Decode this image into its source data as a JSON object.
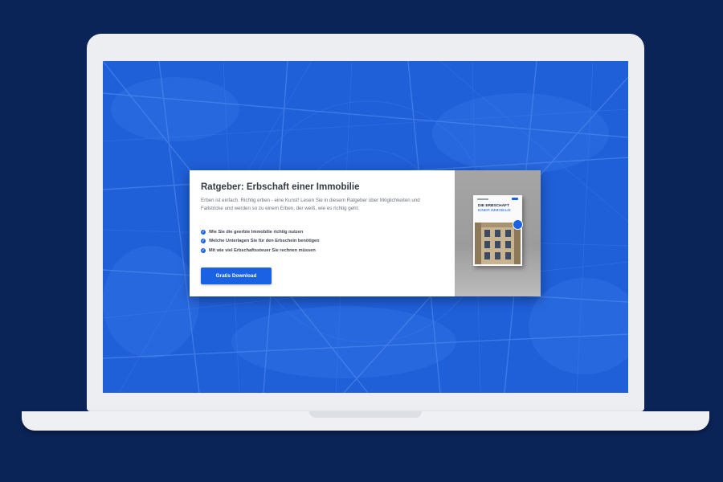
{
  "card": {
    "title": "Ratgeber: Erbschaft einer Immobilie",
    "description": "Erben ist einfach. Richtig erben - eine Kunst! Lesen Sie in diesem Ratgeber über Möglichkeiten und Fallstricke und werden so zu einem Erben, der weiß, wie es richtig geht.",
    "benefits": [
      "Wie Sie die geerbte Immobilie richtig nutzen",
      "Welche Unterlagen Sie für den Erbschein benötigen",
      "Mit wie viel Erbschaftssteuer Sie rechnen müssen"
    ],
    "cta_label": "Gratis Download"
  },
  "book": {
    "title_line1": "DIE ERBSCHAFT",
    "title_line2": "EINER IMMOBILIE"
  },
  "icons": {
    "benefit_check": "check-circle-icon",
    "device": "laptop"
  },
  "colors": {
    "page_background": "#0b2458",
    "screen_background": "#1f5fd8",
    "accent": "#1a62e3",
    "card_background": "#ffffff"
  }
}
